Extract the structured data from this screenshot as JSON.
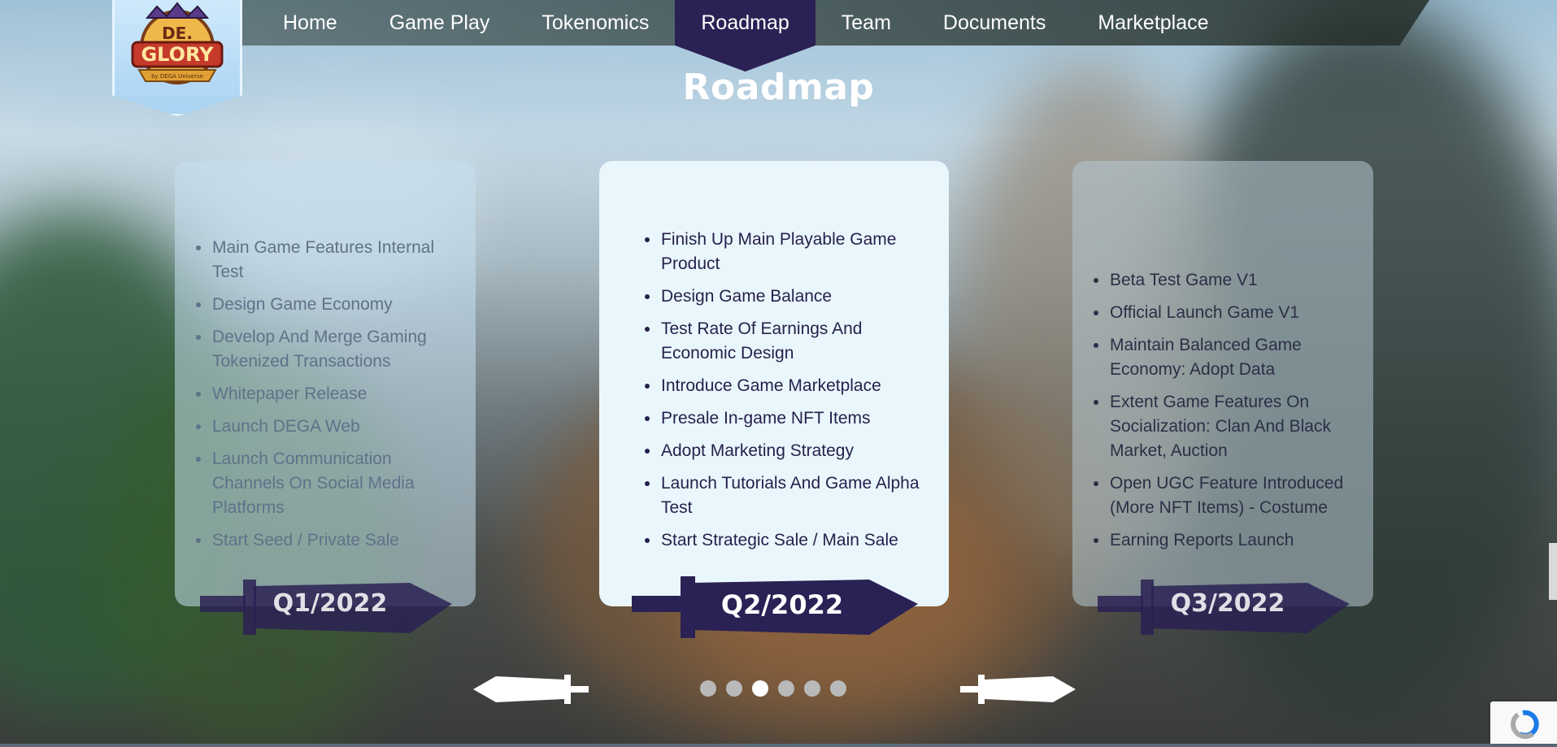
{
  "nav": {
    "items": [
      {
        "label": "Home",
        "active": false
      },
      {
        "label": "Game Play",
        "active": false
      },
      {
        "label": "Tokenomics",
        "active": false
      },
      {
        "label": "Roadmap",
        "active": true
      },
      {
        "label": "Team",
        "active": false
      },
      {
        "label": "Documents",
        "active": false
      },
      {
        "label": "Marketplace",
        "active": false
      }
    ]
  },
  "logo": {
    "line1": "DE.",
    "line2": "GLORY",
    "tagline": "by DEGA Universe"
  },
  "section": {
    "title": "Roadmap"
  },
  "cards": {
    "left": {
      "quarter": "Q1/2022",
      "items": [
        "Main Game Features Internal Test",
        "Design Game Economy",
        "Develop And Merge Gaming Tokenized Transactions",
        "Whitepaper Release",
        "Launch DEGA Web",
        "Launch Communication Channels On Social Media Platforms",
        "Start Seed / Private Sale"
      ]
    },
    "center": {
      "quarter": "Q2/2022",
      "items": [
        "Finish Up Main Playable Game Product",
        "Design Game Balance",
        "Test Rate Of Earnings And Economic Design",
        "Introduce Game Marketplace",
        "Presale In-game NFT Items",
        "Adopt Marketing Strategy",
        "Launch Tutorials And Game Alpha Test",
        "Start Strategic Sale / Main Sale"
      ]
    },
    "right": {
      "quarter": "Q3/2022",
      "items": [
        "Beta Test Game V1",
        "Official Launch Game V1",
        "Maintain Balanced Game Economy: Adopt Data",
        "Extent Game Features On Socialization: Clan And Black Market, Auction",
        "Open UGC Feature Introduced (More NFT Items) - Costume",
        "Earning Reports Launch"
      ]
    }
  },
  "carousel": {
    "total_pages": 6,
    "active_page": 3
  },
  "colors": {
    "accent": "#2a2154",
    "card_center": "#e9f7fd",
    "white": "#ffffff"
  },
  "icons": {
    "prev": "sword-left-arrow-icon",
    "next": "sword-right-arrow-icon"
  }
}
